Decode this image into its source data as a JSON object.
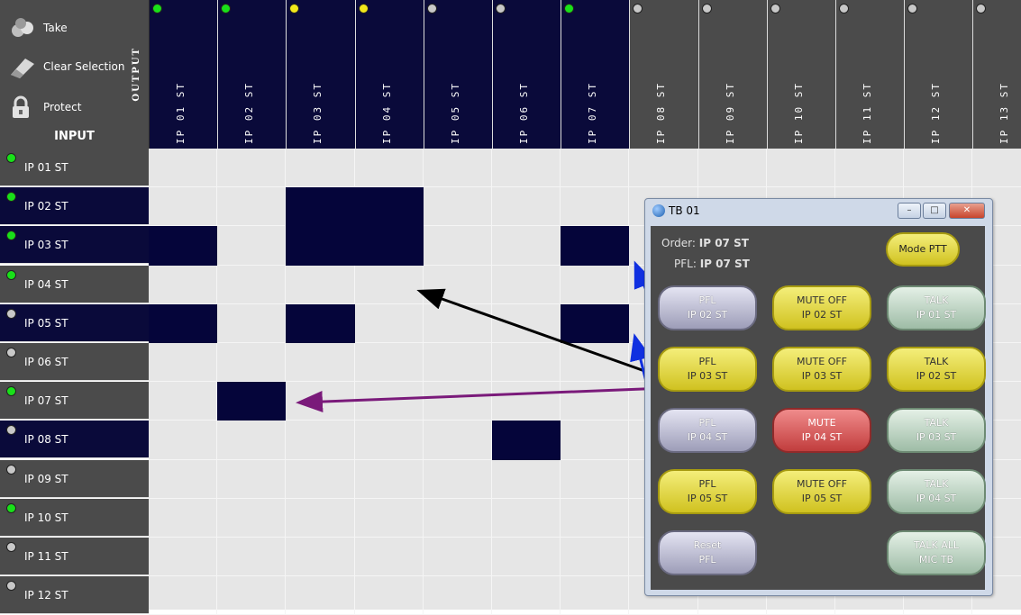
{
  "toolbar": {
    "take_label": "Take",
    "clear_label": "Clear Selection",
    "protect_label": "Protect",
    "output_label": "OUTPUT",
    "input_label": "INPUT"
  },
  "outputs": [
    {
      "label": "IP 01 ST",
      "status": "green"
    },
    {
      "label": "IP 02 ST",
      "status": "green"
    },
    {
      "label": "IP 03 ST",
      "status": "yellow"
    },
    {
      "label": "IP 04 ST",
      "status": "yellow"
    },
    {
      "label": "IP 05 ST",
      "status": "grey"
    },
    {
      "label": "IP 06 ST",
      "status": "grey"
    },
    {
      "label": "IP 07 ST",
      "status": "green"
    },
    {
      "label": "IP 08 ST",
      "status": "grey"
    },
    {
      "label": "IP 09 ST",
      "status": "grey"
    },
    {
      "label": "IP 10 ST",
      "status": "grey"
    },
    {
      "label": "IP 11 ST",
      "status": "grey"
    },
    {
      "label": "IP 12 ST",
      "status": "grey"
    },
    {
      "label": "IP 13 ST",
      "status": "grey"
    }
  ],
  "inputs": [
    {
      "label": "IP 01 ST",
      "status": "green",
      "active": false
    },
    {
      "label": "IP 02 ST",
      "status": "green",
      "active": true
    },
    {
      "label": "IP 03 ST",
      "status": "green",
      "active": true
    },
    {
      "label": "IP 04 ST",
      "status": "green",
      "active": false
    },
    {
      "label": "IP 05 ST",
      "status": "grey",
      "active": true
    },
    {
      "label": "IP 06 ST",
      "status": "grey",
      "active": false
    },
    {
      "label": "IP 07 ST",
      "status": "green",
      "active": false
    },
    {
      "label": "IP 08 ST",
      "status": "grey",
      "active": true
    },
    {
      "label": "IP 09 ST",
      "status": "grey",
      "active": false
    },
    {
      "label": "IP 10 ST",
      "status": "green",
      "active": false
    },
    {
      "label": "IP 11 ST",
      "status": "grey",
      "active": false
    },
    {
      "label": "IP 12 ST",
      "status": "grey",
      "active": false
    }
  ],
  "crosspoints": [
    [
      1,
      2
    ],
    [
      1,
      3
    ],
    [
      2,
      0
    ],
    [
      2,
      2
    ],
    [
      2,
      3
    ],
    [
      2,
      6
    ],
    [
      4,
      0
    ],
    [
      4,
      2
    ],
    [
      4,
      6
    ],
    [
      6,
      1
    ],
    [
      7,
      5
    ]
  ],
  "colors": {
    "green": "#19e019",
    "yellow": "#f2e81a",
    "grey": "#c8c8c8",
    "active_bg": "#0a0a3a",
    "inactive_bg": "#4b4b4b"
  },
  "dialog": {
    "title": "TB 01",
    "order_label": "Order:",
    "order_value": "IP 07 ST",
    "pfl_label": "PFL:",
    "pfl_value": "IP 07 ST",
    "mode_label": "Mode PTT",
    "buttons": [
      {
        "l1": "PFL",
        "l2": "IP 02 ST",
        "style": "lav"
      },
      {
        "l1": "MUTE OFF",
        "l2": "IP 02 ST",
        "style": "yel"
      },
      {
        "l1": "TALK",
        "l2": "IP 01 ST",
        "style": "grn"
      },
      {
        "l1": "PFL",
        "l2": "IP 03 ST",
        "style": "yel"
      },
      {
        "l1": "MUTE OFF",
        "l2": "IP 03 ST",
        "style": "yel"
      },
      {
        "l1": "TALK",
        "l2": "IP 02 ST",
        "style": "yel"
      },
      {
        "l1": "PFL",
        "l2": "IP 04 ST",
        "style": "lav"
      },
      {
        "l1": "MUTE",
        "l2": "IP 04 ST",
        "style": "red"
      },
      {
        "l1": "TALK",
        "l2": "IP 03 ST",
        "style": "grn"
      },
      {
        "l1": "PFL",
        "l2": "IP 05 ST",
        "style": "yel"
      },
      {
        "l1": "MUTE OFF",
        "l2": "IP 05 ST",
        "style": "yel"
      },
      {
        "l1": "TALK",
        "l2": "IP 04 ST",
        "style": "grn"
      },
      {
        "l1": "Reset",
        "l2": "PFL",
        "style": "lav"
      },
      null,
      {
        "l1": "TALK ALL",
        "l2": "MIC TB",
        "style": "grn"
      }
    ]
  }
}
